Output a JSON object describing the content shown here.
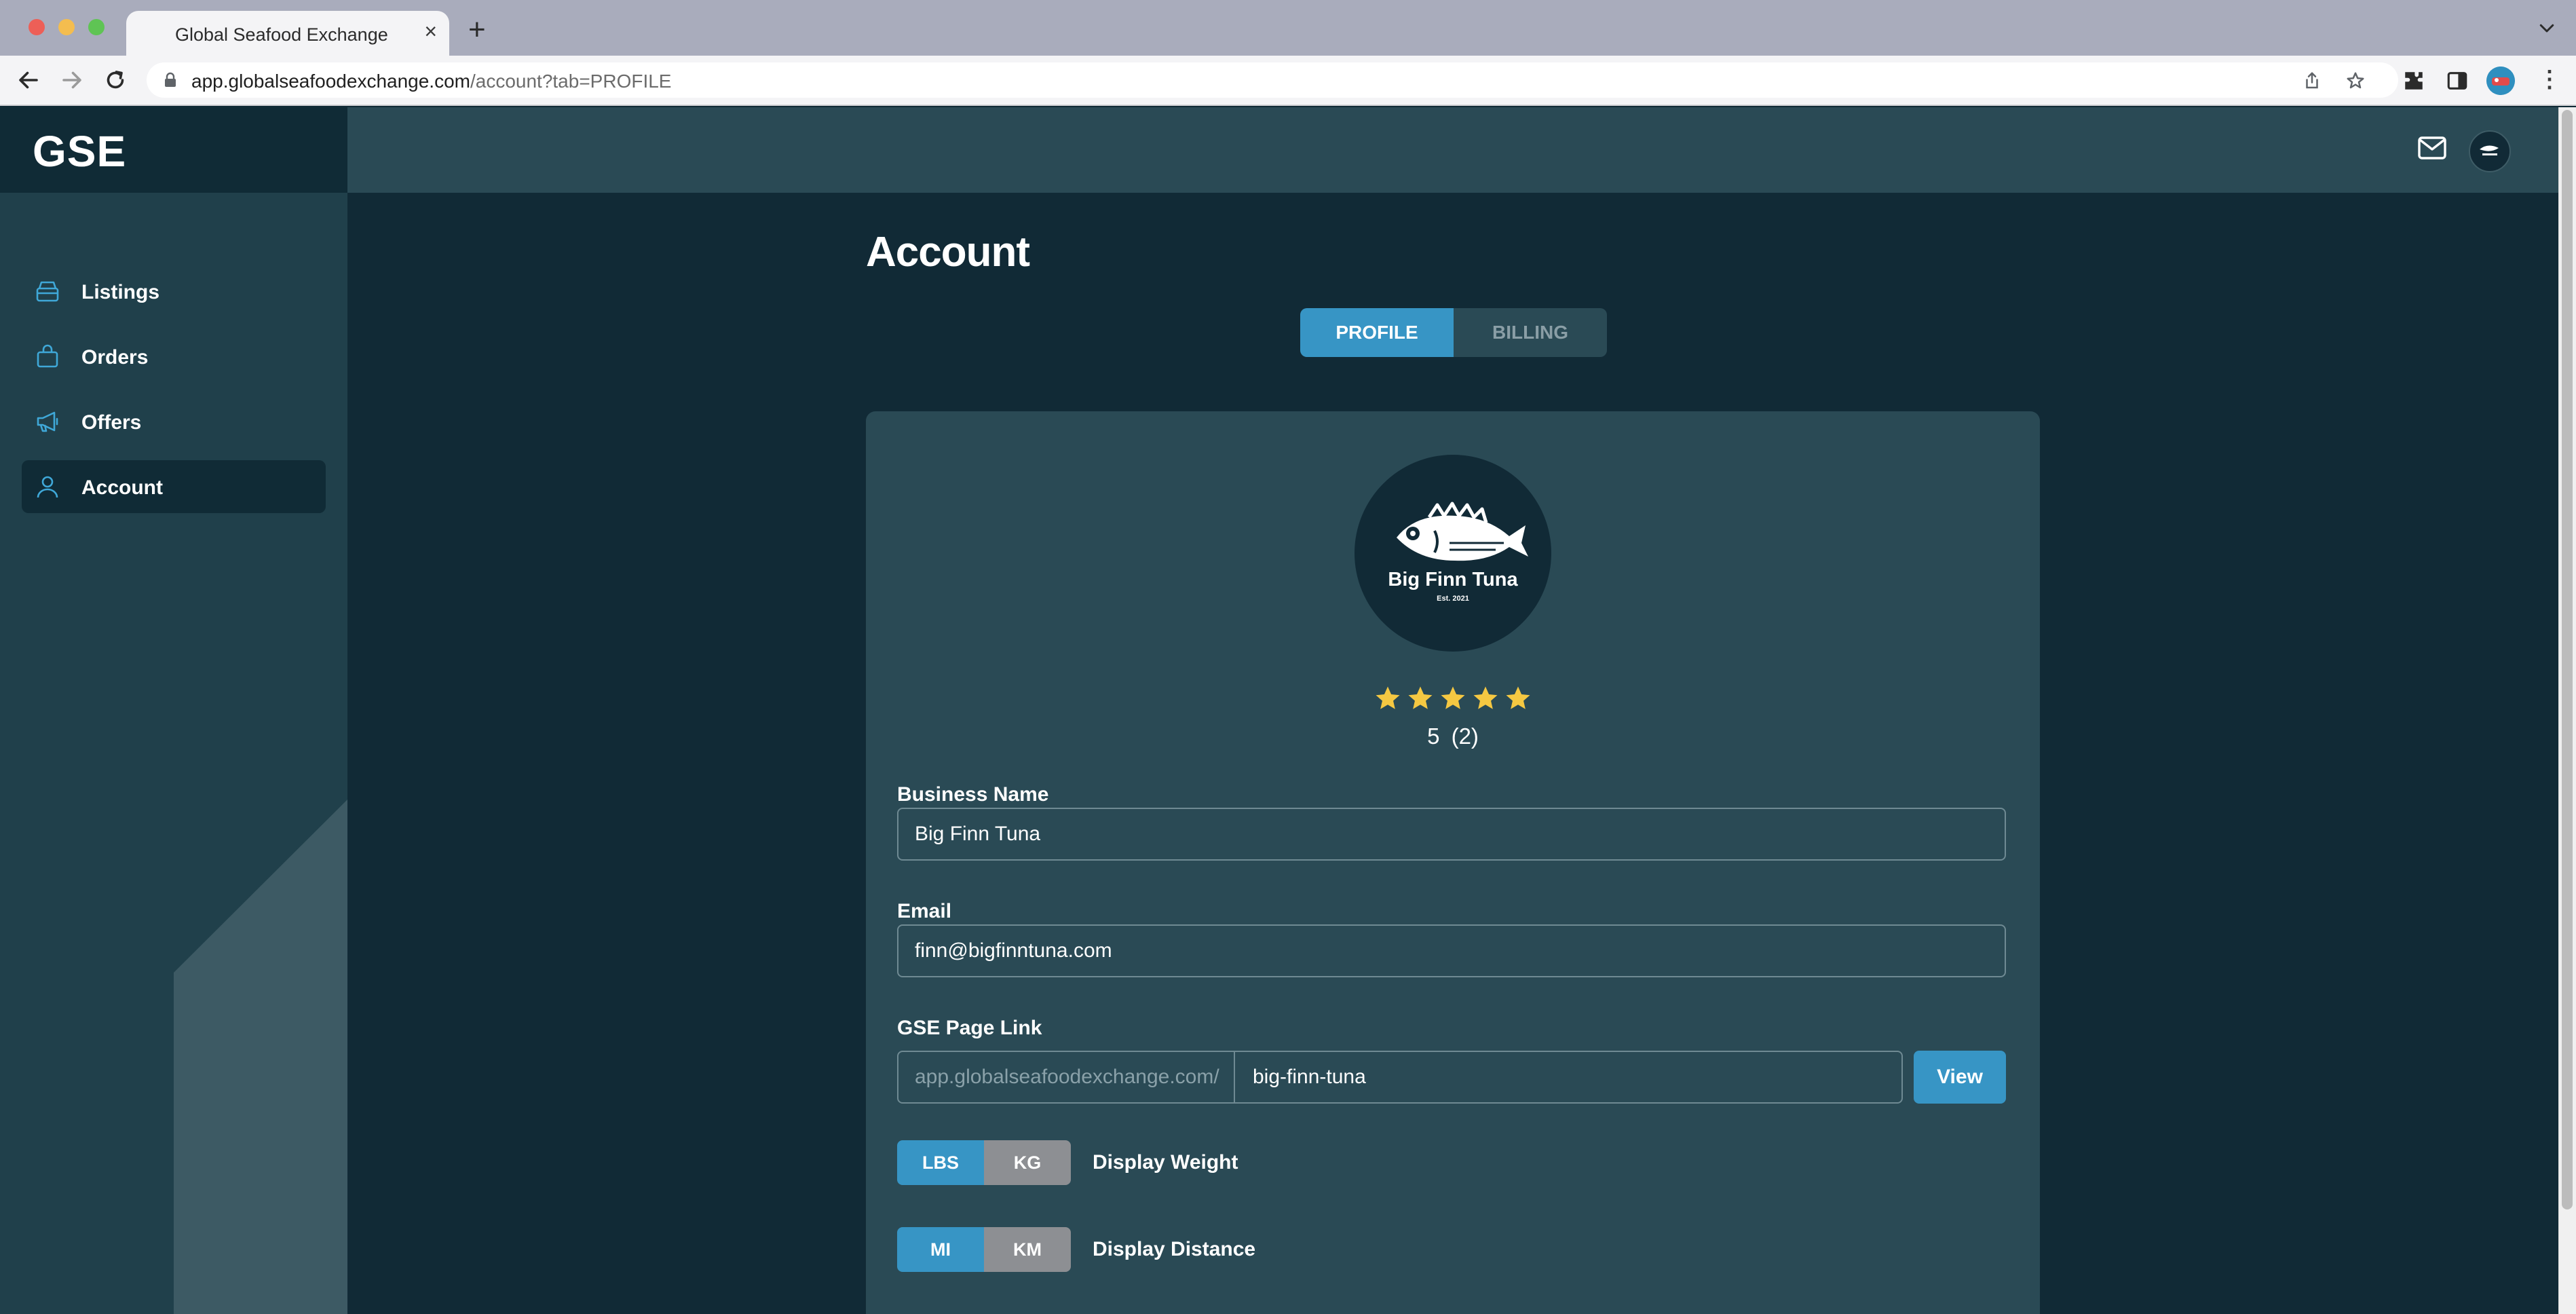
{
  "browser": {
    "tab_title": "Global Seafood Exchange",
    "tab_close": "×",
    "new_tab": "+",
    "url_host": "app.globalseafoodexchange.com",
    "url_path": "/account?tab=PROFILE",
    "menu": "⋮"
  },
  "app": {
    "logo": "GSE"
  },
  "sidebar": {
    "items": [
      {
        "label": "Listings",
        "icon": "box-icon"
      },
      {
        "label": "Orders",
        "icon": "bag-icon"
      },
      {
        "label": "Offers",
        "icon": "megaphone-icon"
      },
      {
        "label": "Account",
        "icon": "user-icon",
        "active": true
      }
    ]
  },
  "page": {
    "title": "Account",
    "tabs": [
      {
        "label": "PROFILE",
        "active": true
      },
      {
        "label": "BILLING",
        "active": false
      }
    ]
  },
  "profile": {
    "logo_name": "Big Finn Tuna",
    "logo_est": "Est. 2021",
    "rating": {
      "score": "5",
      "count": "(2)",
      "stars": 5
    },
    "business_name": {
      "label": "Business Name",
      "value": "Big Finn Tuna"
    },
    "email": {
      "label": "Email",
      "value": "finn@bigfinntuna.com"
    },
    "page_link": {
      "label": "GSE Page Link",
      "prefix": "app.globalseafoodexchange.com/",
      "value": "big-finn-tuna",
      "button": "View"
    },
    "display_weight": {
      "label": "Display Weight",
      "options": [
        "LBS",
        "KG"
      ],
      "selected": "LBS"
    },
    "display_distance": {
      "label": "Display Distance",
      "options": [
        "MI",
        "KM"
      ],
      "selected": "MI"
    }
  },
  "colors": {
    "accent": "#3795c5",
    "sidebar_bg": "#20404b",
    "main_bg": "#112a36",
    "card_bg": "#2a4a55",
    "star": "#f5c842"
  }
}
